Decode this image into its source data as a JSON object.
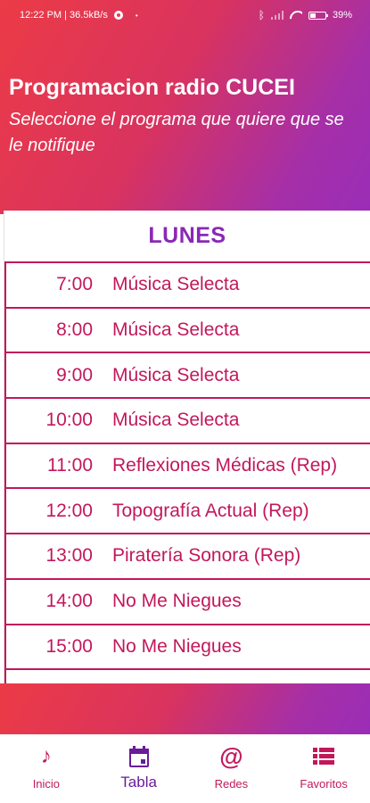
{
  "status_bar": {
    "time_speed": "12:22 PM | 36.5kB/s",
    "battery": "39%",
    "dot": "•"
  },
  "header": {
    "title": "Programacion radio CUCEI",
    "subtitle": "Seleccione el programa que quiere que se le notifique"
  },
  "schedule": {
    "day": "LUNES",
    "rows": [
      {
        "time": "7:00",
        "program": "Música Selecta"
      },
      {
        "time": "8:00",
        "program": "Música Selecta"
      },
      {
        "time": "9:00",
        "program": "Música Selecta"
      },
      {
        "time": "10:00",
        "program": "Música Selecta"
      },
      {
        "time": "11:00",
        "program": "Reflexiones Médicas (Rep)"
      },
      {
        "time": "12:00",
        "program": "Topografía Actual (Rep)"
      },
      {
        "time": "13:00",
        "program": "Piratería Sonora (Rep)"
      },
      {
        "time": "14:00",
        "program": "No Me Niegues"
      },
      {
        "time": "15:00",
        "program": "No Me Niegues"
      }
    ]
  },
  "bottom_nav": {
    "items": [
      {
        "label": "Inicio",
        "icon": "music-note-icon",
        "active": false
      },
      {
        "label": "Tabla",
        "icon": "calendar-icon",
        "active": true
      },
      {
        "label": "Redes",
        "icon": "at-sign-icon",
        "active": false
      },
      {
        "label": "Favoritos",
        "icon": "list-icon",
        "active": false
      }
    ]
  },
  "colors": {
    "gradient_start": "#ec3b46",
    "gradient_end": "#9a2db7",
    "row_text": "#c2185b",
    "day_header": "#8a28b5",
    "nav_active": "#6a1b9a"
  }
}
